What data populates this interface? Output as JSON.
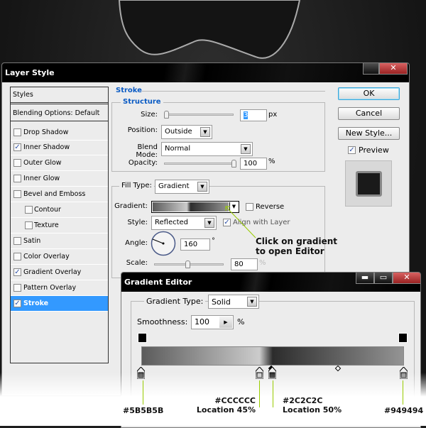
{
  "layer_style": {
    "title": "Layer Style",
    "styles_header": "Styles",
    "blending": "Blending Options: Default",
    "items": [
      {
        "label": "Drop Shadow",
        "checked": false
      },
      {
        "label": "Inner Shadow",
        "checked": true
      },
      {
        "label": "Outer Glow",
        "checked": false
      },
      {
        "label": "Inner Glow",
        "checked": false
      },
      {
        "label": "Bevel and Emboss",
        "checked": false
      },
      {
        "label": "Contour",
        "checked": false
      },
      {
        "label": "Texture",
        "checked": false
      },
      {
        "label": "Satin",
        "checked": false
      },
      {
        "label": "Color Overlay",
        "checked": false
      },
      {
        "label": "Gradient Overlay",
        "checked": true
      },
      {
        "label": "Pattern Overlay",
        "checked": false
      },
      {
        "label": "Stroke",
        "checked": true
      }
    ],
    "section": "Stroke",
    "structure": "Structure",
    "size_label": "Size:",
    "size_value": "3",
    "size_unit": "px",
    "position_label": "Position:",
    "position_value": "Outside",
    "blend_label": "Blend Mode:",
    "blend_value": "Normal",
    "opacity_label": "Opacity:",
    "opacity_value": "100",
    "opacity_unit": "%",
    "fill_type_label": "Fill Type:",
    "fill_type_value": "Gradient",
    "gradient_label": "Gradient:",
    "reverse_label": "Reverse",
    "style_label": "Style:",
    "style_value": "Reflected",
    "align_label": "Align with Layer",
    "angle_label": "Angle:",
    "angle_value": "160",
    "angle_unit": "°",
    "scale_label": "Scale:",
    "scale_value": "80",
    "scale_unit": "%",
    "ok": "OK",
    "cancel": "Cancel",
    "new_style": "New Style...",
    "preview": "Preview"
  },
  "callout": {
    "line1": "Click on gradient",
    "line2": "to open Editor",
    "color": "#99cc00"
  },
  "gradient_editor": {
    "title": "Gradient Editor",
    "type_label": "Gradient Type:",
    "type_value": "Solid",
    "smooth_label": "Smoothness:",
    "smooth_value": "100",
    "smooth_unit": "%",
    "stops": [
      {
        "color": "#5B5B5B",
        "location": 0,
        "label": "#5B5B5B",
        "loc_label": ""
      },
      {
        "color": "#CCCCCC",
        "location": 45,
        "label": "#CCCCCC",
        "loc_label": "Location 45%"
      },
      {
        "color": "#2C2C2C",
        "location": 50,
        "label": "#2C2C2C",
        "loc_label": "Location 50%"
      },
      {
        "color": "#949494",
        "location": 100,
        "label": "#949494",
        "loc_label": ""
      }
    ]
  }
}
